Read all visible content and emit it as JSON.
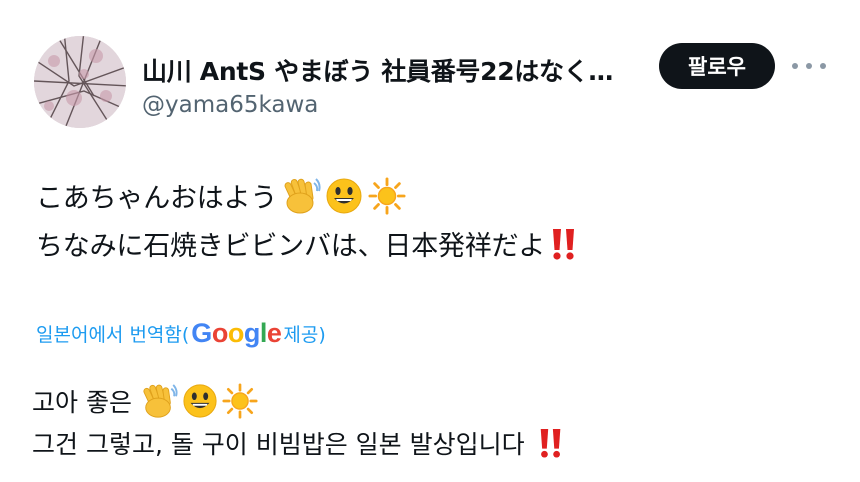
{
  "author": {
    "display_name": "山川 AntS やまぼう 社員番号22はなく…",
    "handle": "@yama65kawa"
  },
  "follow_button": {
    "label": "팔로우"
  },
  "tweet": {
    "line1": "こあちゃんおはよう",
    "line2": "ちなみに石焼きビビンバは、日本発祥だよ"
  },
  "translation": {
    "label_prefix": "일본어에서 번역함(",
    "provider": "Google",
    "label_suffix": " 제공)",
    "line1": "고아 좋은",
    "line2": "그건 그렇고, 돌 구이 비빔밥은 일본 발상입니다"
  },
  "icons": {
    "avatar": "cherry-blossom-photo",
    "emoji_1": "waving-hand",
    "emoji_2": "grinning-face",
    "emoji_3": "sun",
    "emoji_4": "double-exclamation-mark"
  },
  "colors": {
    "text": "#0f1419",
    "secondary_text": "#536471",
    "link": "#1d9bf0",
    "button_bg": "#0f1419",
    "button_text": "#ffffff"
  }
}
